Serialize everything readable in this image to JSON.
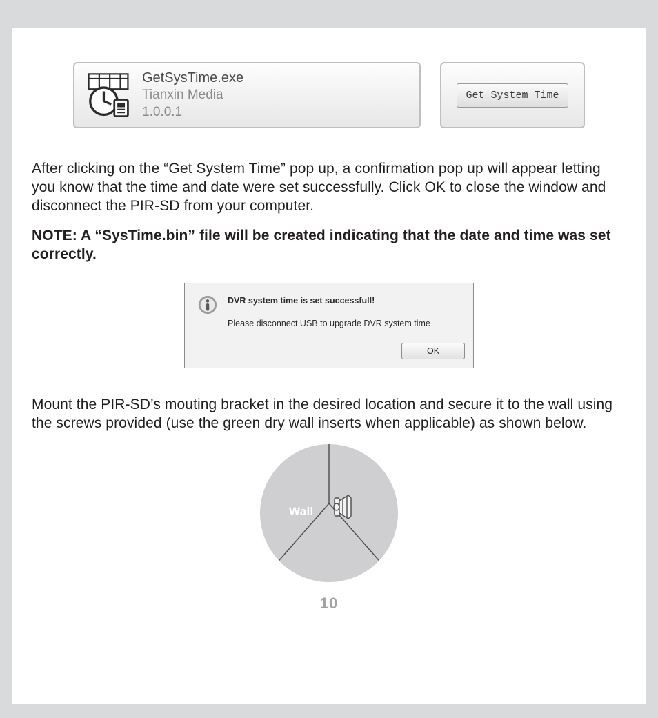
{
  "file_tile": {
    "name": "GetSysTime.exe",
    "publisher": "Tianxin Media",
    "version": "1.0.0.1"
  },
  "action_button": {
    "label": "Get System Time"
  },
  "paragraph1": "After clicking on the “Get System Time” pop up, a confirmation pop up will appear letting you know that the time and date were set successfully. Click OK to close the window and disconnect the PIR-SD from your computer.",
  "note_text": "NOTE: A “SysTime.bin” file will be created indicating that the date and time was set correctly.",
  "dialog": {
    "line1": "DVR system time is set successfull!",
    "line2": "Please disconnect USB to upgrade DVR system time",
    "ok": "OK"
  },
  "paragraph2": "Mount the PIR-SD’s mouting bracket in the desired location and secure it to the wall using the screws provided (use the green dry wall inserts when applicable) as shown below.",
  "wall_label": "Wall",
  "page_number": "10"
}
